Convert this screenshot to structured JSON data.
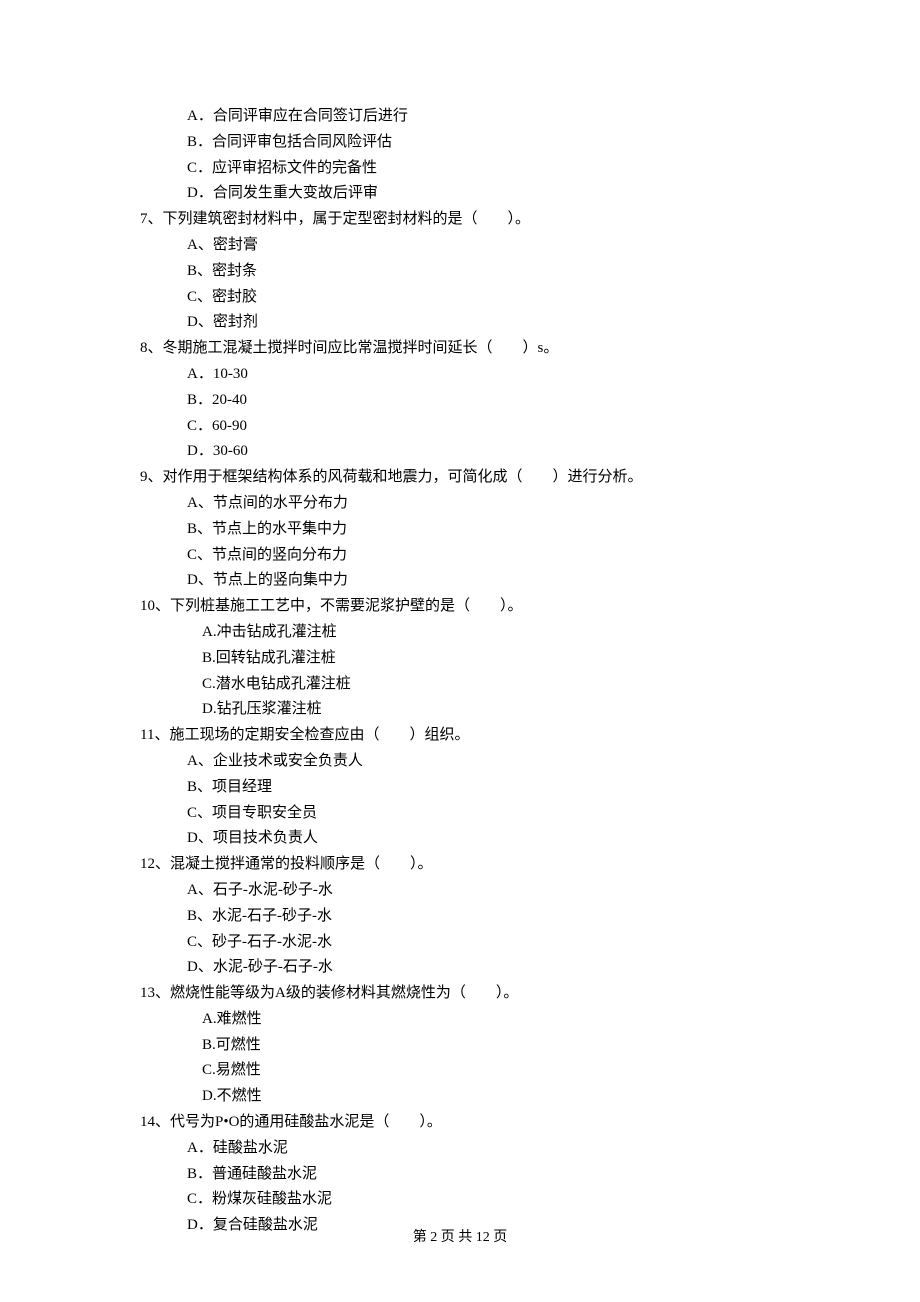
{
  "lines": [
    {
      "cls": "option",
      "text": "A．合同评审应在合同签订后进行"
    },
    {
      "cls": "option",
      "text": "B．合同评审包括合同风险评估"
    },
    {
      "cls": "option",
      "text": "C．应评审招标文件的完备性"
    },
    {
      "cls": "option",
      "text": "D．合同发生重大变故后评审"
    },
    {
      "cls": "question",
      "text": "7、下列建筑密封材料中，属于定型密封材料的是（　　）。"
    },
    {
      "cls": "option",
      "text": "A、密封膏"
    },
    {
      "cls": "option",
      "text": "B、密封条"
    },
    {
      "cls": "option",
      "text": "C、密封胶"
    },
    {
      "cls": "option",
      "text": "D、密封剂"
    },
    {
      "cls": "question",
      "text": "8、冬期施工混凝土搅拌时间应比常温搅拌时间延长（　　）s。"
    },
    {
      "cls": "option",
      "text": "A．10-30"
    },
    {
      "cls": "option",
      "text": "B．20-40"
    },
    {
      "cls": "option",
      "text": "C．60-90"
    },
    {
      "cls": "option",
      "text": "D．30-60"
    },
    {
      "cls": "question",
      "text": "9、对作用于框架结构体系的风荷载和地震力，可简化成（　　）进行分析。"
    },
    {
      "cls": "option",
      "text": "A、节点间的水平分布力"
    },
    {
      "cls": "option",
      "text": "B、节点上的水平集中力"
    },
    {
      "cls": "option",
      "text": "C、节点间的竖向分布力"
    },
    {
      "cls": "option",
      "text": "D、节点上的竖向集中力"
    },
    {
      "cls": "question",
      "text": "10、下列桩基施工工艺中，不需要泥浆护壁的是（　　）。"
    },
    {
      "cls": "sub-option",
      "text": "A.冲击钻成孔灌注桩"
    },
    {
      "cls": "sub-option",
      "text": "B.回转钻成孔灌注桩"
    },
    {
      "cls": "sub-option",
      "text": "C.潜水电钻成孔灌注桩"
    },
    {
      "cls": "sub-option",
      "text": "D.钻孔压浆灌注桩"
    },
    {
      "cls": "question",
      "text": "11、施工现场的定期安全检查应由（　　）组织。"
    },
    {
      "cls": "option",
      "text": "A、企业技术或安全负责人"
    },
    {
      "cls": "option",
      "text": "B、项目经理"
    },
    {
      "cls": "option",
      "text": "C、项目专职安全员"
    },
    {
      "cls": "option",
      "text": "D、项目技术负责人"
    },
    {
      "cls": "question",
      "text": "12、混凝土搅拌通常的投料顺序是（　　）。"
    },
    {
      "cls": "option",
      "text": "A、石子-水泥-砂子-水"
    },
    {
      "cls": "option",
      "text": "B、水泥-石子-砂子-水"
    },
    {
      "cls": "option",
      "text": "C、砂子-石子-水泥-水"
    },
    {
      "cls": "option",
      "text": "D、水泥-砂子-石子-水"
    },
    {
      "cls": "question",
      "text": "13、燃烧性能等级为A级的装修材料其燃烧性为（　　）。"
    },
    {
      "cls": "sub-option",
      "text": "A.难燃性"
    },
    {
      "cls": "sub-option",
      "text": "B.可燃性"
    },
    {
      "cls": "sub-option",
      "text": "C.易燃性"
    },
    {
      "cls": "sub-option",
      "text": "D.不燃性"
    },
    {
      "cls": "question",
      "text": "14、代号为P•O的通用硅酸盐水泥是（　　）。"
    },
    {
      "cls": "option",
      "text": "A．硅酸盐水泥"
    },
    {
      "cls": "option",
      "text": "B．普通硅酸盐水泥"
    },
    {
      "cls": "option",
      "text": "C．粉煤灰硅酸盐水泥"
    },
    {
      "cls": "option",
      "text": "D．复合硅酸盐水泥"
    }
  ],
  "footer": "第 2 页 共 12 页"
}
